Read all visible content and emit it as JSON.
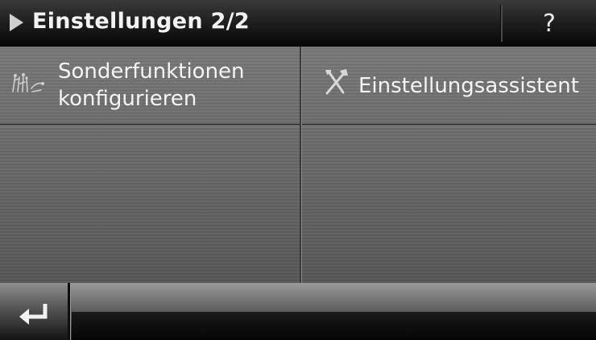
{
  "header": {
    "title": "Einstellungen 2/2",
    "help_label": "?"
  },
  "grid": {
    "items": [
      {
        "label_line1": "Sonderfunktionen",
        "label_line2": "konfigurieren",
        "icon": "special-functions-icon"
      },
      {
        "label": "Einstellungsassistent",
        "icon": "tools-icon"
      }
    ]
  },
  "footer": {
    "back_icon": "return-arrow-icon"
  },
  "colors": {
    "text": "#f4f4f4",
    "header_bg": "#1b1b1b",
    "panel_bg": "#6a6a6a"
  }
}
